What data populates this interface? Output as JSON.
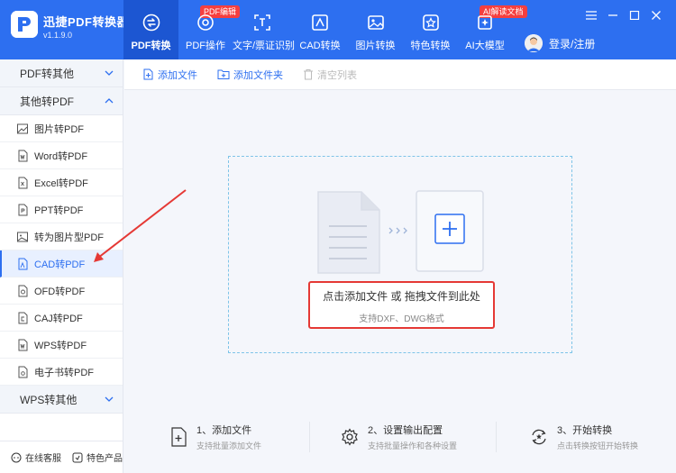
{
  "app": {
    "title": "迅捷PDF转换器",
    "version": "v1.1.9.0"
  },
  "nav": [
    {
      "label": "PDF转换",
      "icon": "convert-icon",
      "active": true
    },
    {
      "label": "PDF操作",
      "icon": "pdf-operation-icon",
      "badge": "PDF编辑"
    },
    {
      "label": "文字/票证识别",
      "icon": "ocr-icon"
    },
    {
      "label": "CAD转换",
      "icon": "cad-icon"
    },
    {
      "label": "图片转换",
      "icon": "image-icon"
    },
    {
      "label": "特色转换",
      "icon": "star-icon"
    },
    {
      "label": "AI大模型",
      "icon": "ai-icon",
      "badge": "AI解读文档"
    }
  ],
  "user": {
    "login_label": "登录/注册"
  },
  "sidebar": {
    "group_pdf_to_other": "PDF转其他",
    "group_other_to_pdf": "其他转PDF",
    "items": [
      {
        "label": "图片转PDF",
        "icon": "image-file-icon"
      },
      {
        "label": "Word转PDF",
        "icon": "word-file-icon"
      },
      {
        "label": "Excel转PDF",
        "icon": "excel-file-icon"
      },
      {
        "label": "PPT转PDF",
        "icon": "ppt-file-icon"
      },
      {
        "label": "转为图片型PDF",
        "icon": "image-pdf-icon"
      },
      {
        "label": "CAD转PDF",
        "icon": "cad-file-icon",
        "active": true
      },
      {
        "label": "OFD转PDF",
        "icon": "ofd-file-icon"
      },
      {
        "label": "CAJ转PDF",
        "icon": "caj-file-icon"
      },
      {
        "label": "WPS转PDF",
        "icon": "wps-file-icon"
      },
      {
        "label": "电子书转PDF",
        "icon": "ebook-file-icon"
      }
    ],
    "group_wps_to_other": "WPS转其他",
    "bottom": {
      "service_label": "在线客服",
      "features_label": "特色产品"
    }
  },
  "toolbar": {
    "add_file_label": "添加文件",
    "add_folder_label": "添加文件夹",
    "clear_list_label": "清空列表"
  },
  "dropzone": {
    "main_text": "点击添加文件 或 拖拽文件到此处",
    "sub_text": "支持DXF、DWG格式"
  },
  "steps": [
    {
      "title": "1、添加文件",
      "sub": "支持批量添加文件",
      "icon": "add-file-step-icon"
    },
    {
      "title": "2、设置输出配置",
      "sub": "支持批量操作和各种设置",
      "icon": "settings-gear-icon"
    },
    {
      "title": "3、开始转换",
      "sub": "点击转换按钮开始转换",
      "icon": "start-convert-icon"
    }
  ],
  "colors": {
    "brand": "#2d6ff0",
    "brand_dark": "#1c56d2",
    "badge": "#f53f3f",
    "highlight": "#e53935",
    "arrow": "#e53935"
  }
}
